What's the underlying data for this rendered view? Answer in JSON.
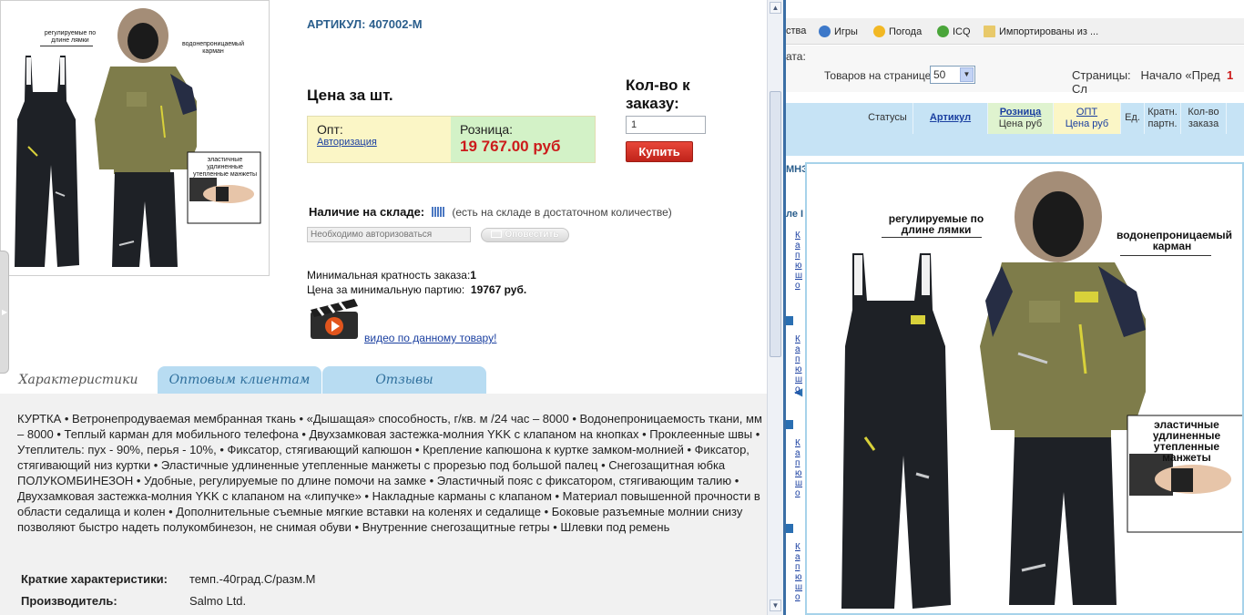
{
  "product": {
    "article": "АРТИКУЛ: 407002-М",
    "price_title": "Цена за шт.",
    "opt_label": "Опт:",
    "opt_link": "Авторизация",
    "retail_label": "Розница:",
    "retail_price": "19 767.00 руб",
    "qty_title": "Кол-во к заказу:",
    "qty_value": "1",
    "buy_label": "Купить",
    "stock_label": "Наличие на складе:",
    "stock_note": "(есть на складе в достаточном количестве)",
    "auth_placeholder": "Необходимо авторизоваться",
    "notify_label": "Оповестить",
    "min_multiplicity_label": "Минимальная кратность заказа:",
    "min_multiplicity_value": "1",
    "min_batch_label": "Цена за минимальную партию:",
    "min_batch_value": "19767 руб.",
    "video_link": "видео по данному товару!"
  },
  "image_labels": {
    "straps": "регулируемые по длине лямки",
    "pocket": "водонепроницаемый карман",
    "cuffs": "эластичные удлиненные утепленные манжеты"
  },
  "tabs": [
    "Характеристики",
    "Оптовым клиентам",
    "Отзывы"
  ],
  "description": "КУРТКА • Ветронепродуваемая мембранная ткань • «Дышащая» способность, г/кв. м /24 час – 8000 • Водонепроницаемость ткани, мм – 8000 • Теплый карман для мобильного телефона • Двухзамковая застежка-молния YKK с клапаном на кнопках • Проклеенные швы • Утеплитель: пух - 90%, перья - 10%, • Фиксатор, стягивающий капюшон • Крепление капюшона к куртке замком-молнией • Фиксатор, стягивающий низ куртки • Эластичные удлиненные утепленные манжеты с прорезью под большой палец • Снегозащитная юбка ПОЛУКОМБИНЕЗОН • Удобные, регулируемые по длине помочи на замке • Эластичный пояс с фиксатором, стягивающим талию • Двухзамковая застежка-молния YKK с клапаном на «липучке» • Накладные карманы с клапаном • Материал повышенной прочности в области седалища и колен • Дополнительные съемные мягкие вставки на коленях и седалище • Боковые разъемные молнии снизу позволяют быстро надеть полукомбинезон, не снимая обуви • Внутренние снегозащитные гетры • Шлевки под ремень",
  "specs": {
    "short_label": "Краткие характеристики:",
    "short_value": "темп.-40град.С/разм.M",
    "maker_label": "Производитель:",
    "maker_value": "Salmo Ltd."
  },
  "browser": {
    "bookmarks": [
      "ства",
      "Игры",
      "Погода",
      "ICQ",
      "Импортированы из ..."
    ],
    "partial_text": "ата:",
    "per_page_label": "Товаров на странице:",
    "per_page_value": "50",
    "pages_label": "Страницы:",
    "pages_start": "Начало",
    "pages_prev": "«Пред",
    "pages_current": "1",
    "pages_next_partial": "Сл"
  },
  "table": {
    "headers": [
      "Статусы",
      "Артикул",
      "Розница",
      "Цена руб",
      "ОПТ",
      "Цена руб",
      "Ед.",
      "Кратн. партн.",
      "Кол-во заказа"
    ],
    "partial_left": "МНЭ",
    "partial_left2": "ле I",
    "row_link": "Капюшон"
  },
  "colors": {
    "accent_blue": "#2a5e8c",
    "price_red": "#cc1b1b",
    "opt_bg": "#fbf6c6",
    "retail_bg": "#d3f2c7",
    "tab_blue": "#b8dcf2",
    "header_blue": "#c6e3f5"
  }
}
